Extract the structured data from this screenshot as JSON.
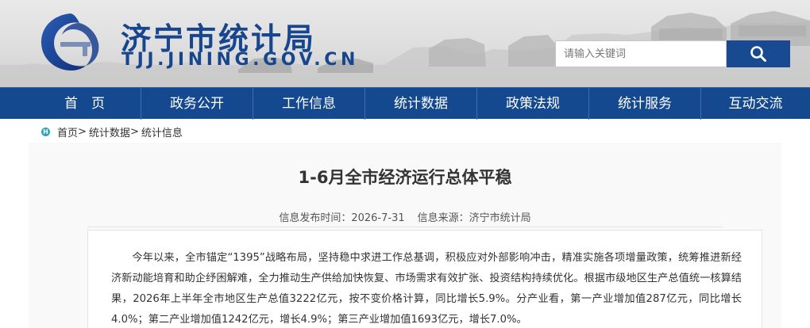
{
  "site": {
    "title": "济宁市统计局",
    "domain": "TJJ.JINING.GOV.CN"
  },
  "search": {
    "placeholder": "请输入关键词"
  },
  "nav": {
    "items": [
      "首　页",
      "政务公开",
      "工作信息",
      "统计数据",
      "政策法规",
      "统计服务",
      "互动交流"
    ]
  },
  "breadcrumb": {
    "home": "首页",
    "sep1": ">",
    "section": "统计数据",
    "sep2": ">",
    "current": "统计信息"
  },
  "article": {
    "title": "1-6月全市经济运行总体平稳",
    "publish_time": "信息发布时间：2026-7-31",
    "source": "信息来源：济宁市统计局",
    "body": "今年以来，全市锚定“1395”战略布局，坚持稳中求进工作总基调，积极应对外部影响冲击，精准实施各项增量政策，统筹推进新经济新动能培育和助企纾困解难，全力推动生产供给加快恢复、市场需求有效扩张、投资结构持续优化。根据市级地区生产总值统一核算结果，2026年上半年全市地区生产总值3222亿元，按不变价格计算，同比增长5.9%。分产业看，第一产业增加值287亿元，同比增长4.0%；第二产业增加值1242亿元，增长4.9%；第三产业增加值1693亿元，增长7.0%。"
  },
  "colors": {
    "brand_blue": "#15498f",
    "title_blue": "#17468f",
    "home_icon": "#2aa7b4"
  }
}
